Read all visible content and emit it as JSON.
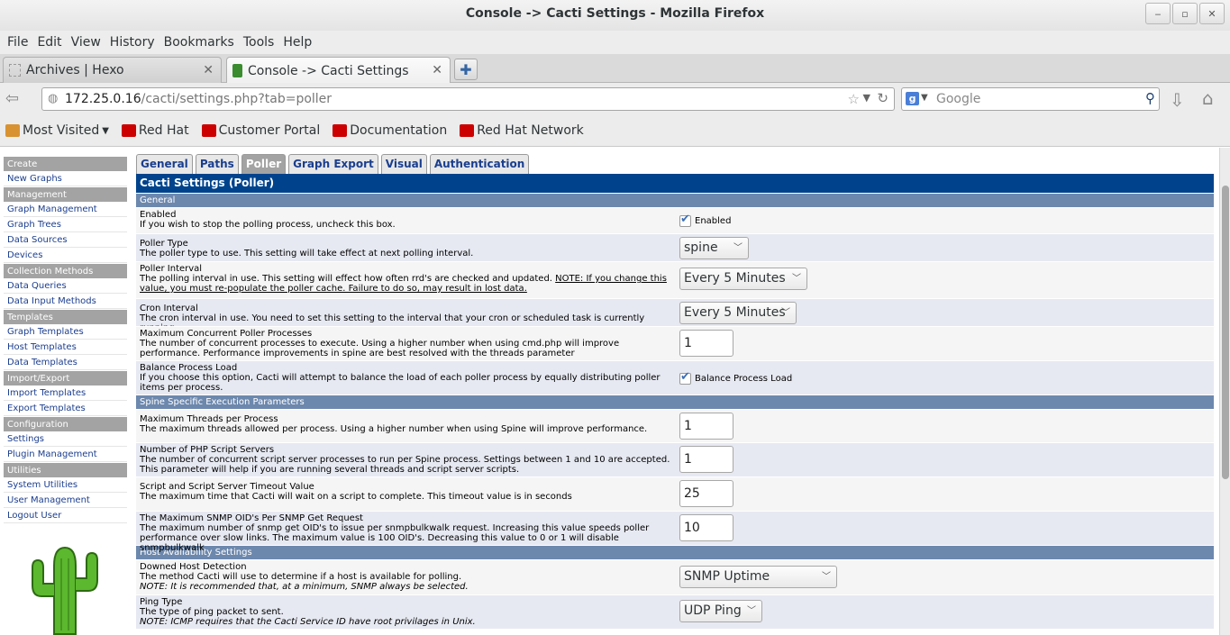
{
  "window": {
    "title": "Console -> Cacti Settings - Mozilla Firefox",
    "min": "‒",
    "max": "▫",
    "close": "✕"
  },
  "menu": [
    "File",
    "Edit",
    "View",
    "History",
    "Bookmarks",
    "Tools",
    "Help"
  ],
  "tabs": [
    {
      "label": "Archives | Hexo",
      "close": "✕"
    },
    {
      "label": "Console -> Cacti Settings",
      "close": "✕"
    }
  ],
  "newtab": "✚",
  "nav": {
    "url_host": "172.25.0.16",
    "url_path": "/cacti/settings.php?tab=poller",
    "search_placeholder": "Google",
    "search_engine_letter": "g"
  },
  "bookmarks": {
    "most_visited": "Most Visited",
    "items": [
      "Red Hat",
      "Customer Portal",
      "Documentation",
      "Red Hat Network"
    ]
  },
  "sidebar": {
    "sections": [
      {
        "head": "Create",
        "items": [
          "New Graphs"
        ]
      },
      {
        "head": "Management",
        "items": [
          "Graph Management",
          "Graph Trees",
          "Data Sources",
          "Devices"
        ]
      },
      {
        "head": "Collection Methods",
        "items": [
          "Data Queries",
          "Data Input Methods"
        ]
      },
      {
        "head": "Templates",
        "items": [
          "Graph Templates",
          "Host Templates",
          "Data Templates"
        ]
      },
      {
        "head": "Import/Export",
        "items": [
          "Import Templates",
          "Export Templates"
        ]
      },
      {
        "head": "Configuration",
        "items": [
          "Settings",
          "Plugin Management"
        ]
      },
      {
        "head": "Utilities",
        "items": [
          "System Utilities",
          "User Management",
          "Logout User"
        ]
      }
    ]
  },
  "settings": {
    "tabs": [
      "General",
      "Paths",
      "Poller",
      "Graph Export",
      "Visual",
      "Authentication"
    ],
    "active_tab": "Poller",
    "panel_title": "Cacti Settings (Poller)",
    "sections": {
      "general": "General",
      "spine": "Spine Specific Execution Parameters",
      "host": "Host Availability Settings"
    },
    "rows": {
      "enabled": {
        "title": "Enabled",
        "desc": "If you wish to stop the polling process, uncheck this box.",
        "control": "Enabled",
        "checked": true
      },
      "poller_type": {
        "title": "Poller Type",
        "desc": "The poller type to use. This setting will take effect at next polling interval.",
        "value": "spine"
      },
      "poller_interval": {
        "title": "Poller Interval",
        "desc": "The polling interval in use. This setting will effect how often rrd's are checked and updated. ",
        "desc_note": "NOTE: If you change this value, you must re-populate the poller cache. Failure to do so, may result in lost data.",
        "value": "Every 5 Minutes"
      },
      "cron_interval": {
        "title": "Cron Interval",
        "desc": "The cron interval in use. You need to set this setting to the interval that your cron or scheduled task is currently running.",
        "value": "Every 5 Minutes"
      },
      "max_procs": {
        "title": "Maximum Concurrent Poller Processes",
        "desc": "The number of concurrent processes to execute. Using a higher number when using cmd.php will improve performance. Performance improvements in spine are best resolved with the threads parameter",
        "value": "1"
      },
      "balance": {
        "title": "Balance Process Load",
        "desc": "If you choose this option, Cacti will attempt to balance the load of each poller process by equally distributing poller items per process.",
        "control": "Balance Process Load",
        "checked": true
      },
      "max_threads": {
        "title": "Maximum Threads per Process",
        "desc": "The maximum threads allowed per process. Using a higher number when using Spine will improve performance.",
        "value": "1"
      },
      "php_servers": {
        "title": "Number of PHP Script Servers",
        "desc": "The number of concurrent script server processes to run per Spine process. Settings between 1 and 10 are accepted. This parameter will help if you are running several threads and script server scripts.",
        "value": "1"
      },
      "timeout": {
        "title": "Script and Script Server Timeout Value",
        "desc": "The maximum time that Cacti will wait on a script to complete. This timeout value is in seconds",
        "value": "25"
      },
      "snmp_oids": {
        "title": "The Maximum SNMP OID's Per SNMP Get Request",
        "desc": "The maximum number of snmp get OID's to issue per snmpbulkwalk request. Increasing this value speeds poller performance over slow links. The maximum value is 100 OID's. Decreasing this value to 0 or 1 will disable snmpbulkwalk",
        "value": "10"
      },
      "downed_host": {
        "title": "Downed Host Detection",
        "desc": "The method Cacti will use to determine if a host is available for polling.",
        "note": "NOTE: It is recommended that, at a minimum, SNMP always be selected.",
        "value": "SNMP Uptime"
      },
      "ping_type": {
        "title": "Ping Type",
        "desc": "The type of ping packet to sent.",
        "note": "NOTE: ICMP requires that the Cacti Service ID have root privilages in Unix.",
        "value": "UDP Ping"
      }
    }
  }
}
